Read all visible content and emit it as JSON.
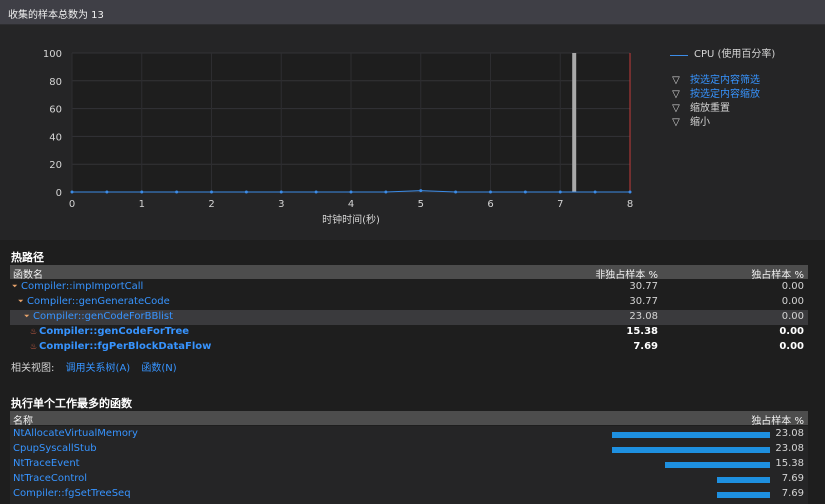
{
  "header": {
    "title": "收集的样本总数为 13"
  },
  "chart_data": {
    "type": "line",
    "title": "",
    "xlabel": "时钟时间(秒)",
    "ylabel": "",
    "xlim": [
      0,
      8
    ],
    "ylim": [
      0,
      100
    ],
    "x_ticks": [
      "0",
      "1",
      "2",
      "3",
      "4",
      "5",
      "6",
      "7",
      "8"
    ],
    "y_ticks": [
      "0",
      "20",
      "40",
      "60",
      "80",
      "100"
    ],
    "series": [
      {
        "name": "CPU (使用百分率)",
        "x": [
          0,
          0.5,
          1,
          1.5,
          2,
          2.5,
          3,
          3.5,
          4,
          4.5,
          5,
          5.5,
          6,
          6.5,
          7,
          7.5,
          8
        ],
        "y": [
          0,
          0,
          0,
          0,
          0,
          0,
          0,
          0,
          0,
          0,
          1,
          0,
          0,
          0,
          0,
          0,
          0
        ]
      }
    ],
    "bars": [
      {
        "x": 7.2,
        "y": 100
      }
    ],
    "marker_x": 8
  },
  "legend": {
    "cpu_label": "CPU (使用百分率)",
    "actions": [
      {
        "label": "按选定内容筛选",
        "icon": "filter-icon",
        "link": true
      },
      {
        "label": "按选定内容缩放",
        "icon": "filter-icon",
        "link": true
      },
      {
        "label": "缩放重置",
        "icon": "filter-icon",
        "link": false
      },
      {
        "label": "缩小",
        "icon": "filter-icon",
        "link": false
      }
    ]
  },
  "hot_path": {
    "title": "热路径",
    "columns": [
      "函数名",
      "非独占样本 %",
      "独占样本 %"
    ],
    "rows": [
      {
        "name": "Compiler::impImportCall",
        "inclusive": "30.77",
        "exclusive": "0.00",
        "indent": 0,
        "hot": false
      },
      {
        "name": "Compiler::genGenerateCode",
        "inclusive": "30.77",
        "exclusive": "0.00",
        "indent": 1,
        "hot": false
      },
      {
        "name": "Compiler::genCodeForBBlist",
        "inclusive": "23.08",
        "exclusive": "0.00",
        "indent": 2,
        "hot": false
      },
      {
        "name": "Compiler::genCodeForTree",
        "inclusive": "15.38",
        "exclusive": "0.00",
        "indent": 3,
        "hot": true
      },
      {
        "name": "Compiler::fgPerBlockDataFlow",
        "inclusive": "7.69",
        "exclusive": "0.00",
        "indent": 3,
        "hot": true
      }
    ]
  },
  "related_views": {
    "label": "相关视图:",
    "links": [
      "调用关系树(A)",
      "函数(N)"
    ]
  },
  "top_functions": {
    "title": "执行单个工作最多的函数",
    "columns": [
      "名称",
      "独占样本 %"
    ],
    "rows": [
      {
        "name": "NtAllocateVirtualMemory",
        "value": "23.08",
        "pct": 23.08
      },
      {
        "name": "CpupSyscallStub",
        "value": "23.08",
        "pct": 23.08
      },
      {
        "name": "NtTraceEvent",
        "value": "15.38",
        "pct": 15.38
      },
      {
        "name": "NtTraceControl",
        "value": "7.69",
        "pct": 7.69
      },
      {
        "name": "Compiler::fgSetTreeSeq",
        "value": "7.69",
        "pct": 7.69
      }
    ]
  }
}
